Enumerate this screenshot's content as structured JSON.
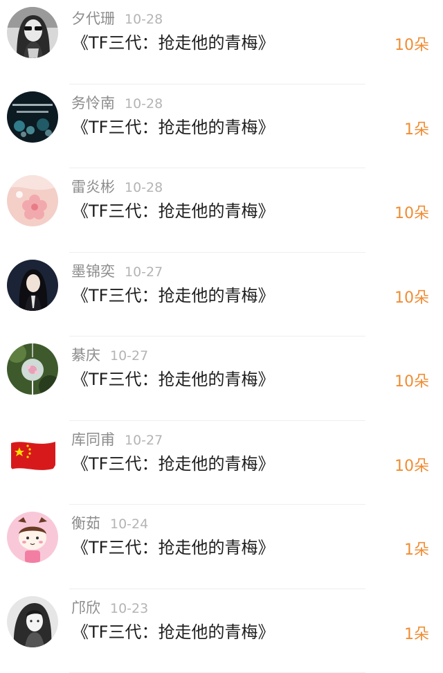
{
  "gifts": [
    {
      "name": "夕代珊",
      "date": "10-28",
      "title": "《TF三代：抢走他的青梅》",
      "amount": "10朵",
      "avatar_icon": "girl-sunglasses-bw-avatar"
    },
    {
      "name": "务怜南",
      "date": "10-28",
      "title": "《TF三代：抢走他的青梅》",
      "amount": "1朵",
      "avatar_icon": "bokeh-night-text-avatar"
    },
    {
      "name": "雷炎彬",
      "date": "10-28",
      "title": "《TF三代：抢走他的青梅》",
      "amount": "10朵",
      "avatar_icon": "pink-flower-avatar"
    },
    {
      "name": "墨锦奕",
      "date": "10-27",
      "title": "《TF三代：抢走他的青梅》",
      "amount": "10朵",
      "avatar_icon": "dark-haired-girl-avatar"
    },
    {
      "name": "綦庆",
      "date": "10-27",
      "title": "《TF三代：抢走他的青梅》",
      "amount": "10朵",
      "avatar_icon": "wind-chime-avatar"
    },
    {
      "name": "库同甫",
      "date": "10-27",
      "title": "《TF三代：抢走他的青梅》",
      "amount": "10朵",
      "avatar_icon": "china-flag-avatar"
    },
    {
      "name": "衡茹",
      "date": "10-24",
      "title": "《TF三代：抢走他的青梅》",
      "amount": "1朵",
      "avatar_icon": "cartoon-girl-avatar"
    },
    {
      "name": "邝欣",
      "date": "10-23",
      "title": "《TF三代：抢走他的青梅》",
      "amount": "1朵",
      "avatar_icon": "bw-girl-portrait-avatar"
    }
  ],
  "colors": {
    "name": "#8c8c8c",
    "date": "#b4b4b4",
    "title": "#1e1e1e",
    "amount": "#f08c32",
    "divider": "#eeeeee"
  }
}
